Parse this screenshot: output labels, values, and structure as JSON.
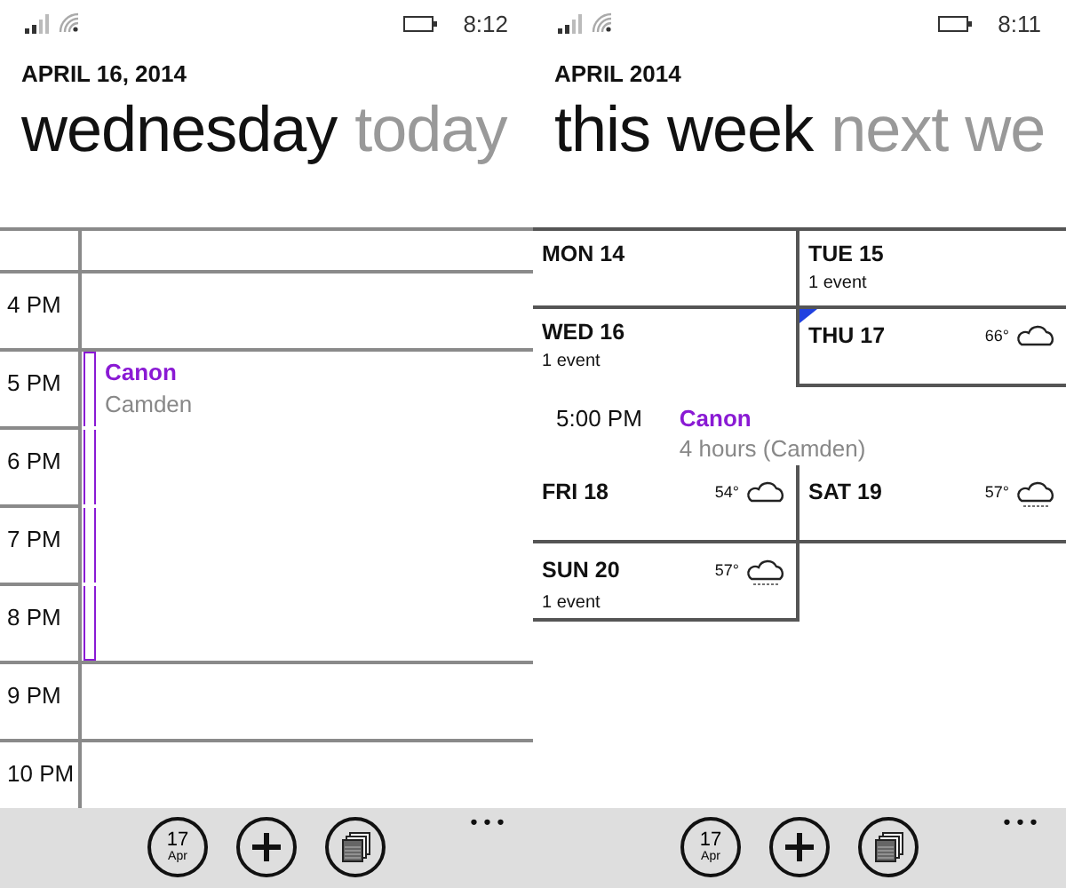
{
  "screens": [
    {
      "kind": "day",
      "status": {
        "time": "8:12"
      },
      "heading": "APRIL 16, 2014",
      "pivots": [
        {
          "label": "wednesday",
          "selected": true
        },
        {
          "label": "today",
          "selected": false
        }
      ],
      "hours": [
        {
          "label": "4 PM",
          "busy": false
        },
        {
          "label": "5 PM",
          "busy": true
        },
        {
          "label": "6 PM",
          "busy": true
        },
        {
          "label": "7 PM",
          "busy": true
        },
        {
          "label": "8 PM",
          "busy": true
        },
        {
          "label": "9 PM",
          "busy": false
        },
        {
          "label": "10 PM",
          "busy": false
        }
      ],
      "event": {
        "title": "Canon",
        "location": "Camden",
        "color": "#8a1ad4"
      },
      "app_bar": {
        "day": "17",
        "month": "Apr",
        "more": "•••"
      }
    },
    {
      "kind": "week",
      "status": {
        "time": "8:11"
      },
      "heading": "APRIL 2014",
      "pivots": [
        {
          "label": "this week",
          "selected": true
        },
        {
          "label": "next we",
          "selected": false
        }
      ],
      "days": [
        {
          "label": "MON 14",
          "expanded": false,
          "selected": false
        },
        {
          "label": "TUE 15",
          "events": "1 event",
          "expanded": false,
          "selected": false
        },
        {
          "label": "WED 16",
          "events": "1 event",
          "expanded": true,
          "selected": false,
          "agenda": [
            {
              "time": "5:00 PM",
              "title": "Canon",
              "detail": "4 hours (Camden)",
              "color": "#8a1ad4"
            }
          ]
        },
        {
          "label": "THU 17",
          "expanded": false,
          "selected": true,
          "weather": {
            "temp": "66°",
            "kind": "cloud"
          }
        },
        {
          "label": "FRI 18",
          "expanded": false,
          "selected": false,
          "weather": {
            "temp": "54°",
            "kind": "cloud"
          }
        },
        {
          "label": "SAT 19",
          "expanded": false,
          "selected": false,
          "weather": {
            "temp": "57°",
            "kind": "rain"
          }
        },
        {
          "label": "SUN 20",
          "events": "1 event",
          "expanded": false,
          "selected": false,
          "weather": {
            "temp": "57°",
            "kind": "rain"
          }
        }
      ],
      "app_bar": {
        "day": "17",
        "month": "Apr",
        "more": "•••"
      }
    }
  ]
}
